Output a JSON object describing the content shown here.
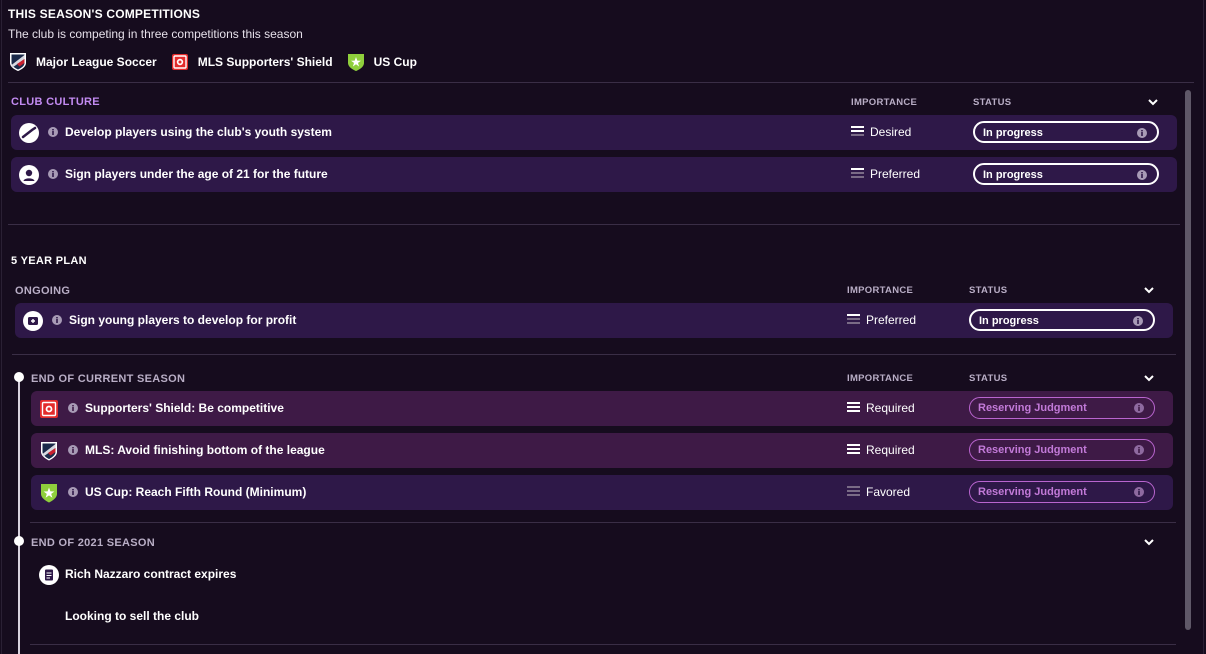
{
  "competitions": {
    "title": "THIS SEASON'S COMPETITIONS",
    "subtitle": "The club is competing in three competitions this season",
    "items": [
      {
        "name": "Major League Soccer",
        "icon": "mls-crest-icon"
      },
      {
        "name": "MLS Supporters' Shield",
        "icon": "supporters-shield-icon"
      },
      {
        "name": "US Cup",
        "icon": "us-cup-icon"
      }
    ]
  },
  "club_culture": {
    "label": "CLUB CULTURE",
    "importance_header": "IMPORTANCE",
    "status_header": "STATUS",
    "rows": [
      {
        "text": "Develop players using the club's youth system",
        "importance": "Desired",
        "status": "In progress",
        "icon": "youth-development-icon"
      },
      {
        "text": "Sign players under the age of 21 for the future",
        "importance": "Preferred",
        "status": "In progress",
        "icon": "player-silhouette-icon"
      }
    ]
  },
  "five_year_plan": {
    "label": "5 YEAR PLAN",
    "ongoing": {
      "label": "ONGOING",
      "importance_header": "IMPORTANCE",
      "status_header": "STATUS",
      "rows": [
        {
          "text": "Sign young players to develop for profit",
          "importance": "Preferred",
          "status": "In progress",
          "icon": "transfer-profit-icon"
        }
      ]
    },
    "end_current_season": {
      "label": "END OF CURRENT SEASON",
      "importance_header": "IMPORTANCE",
      "status_header": "STATUS",
      "rows": [
        {
          "text": "Supporters' Shield: Be competitive",
          "importance": "Required",
          "status": "Reserving Judgment",
          "icon": "supporters-shield-icon"
        },
        {
          "text": "MLS: Avoid finishing bottom of the league",
          "importance": "Required",
          "status": "Reserving Judgment",
          "icon": "mls-crest-icon"
        },
        {
          "text": "US Cup: Reach Fifth Round (Minimum)",
          "importance": "Favored",
          "status": "Reserving Judgment",
          "icon": "us-cup-icon"
        }
      ]
    },
    "end_2021_season": {
      "label": "END OF 2021 SEASON",
      "items": [
        {
          "text": "Rich Nazzaro contract expires",
          "icon": "contract-icon"
        },
        {
          "text": "Looking to sell the club"
        }
      ]
    }
  },
  "colors": {
    "background": "#160c1e",
    "row_dark": "#2e1848",
    "row_pink": "#3e1a46",
    "accent_purple": "#c38bf2",
    "reserving_pink": "#c27ad8"
  }
}
